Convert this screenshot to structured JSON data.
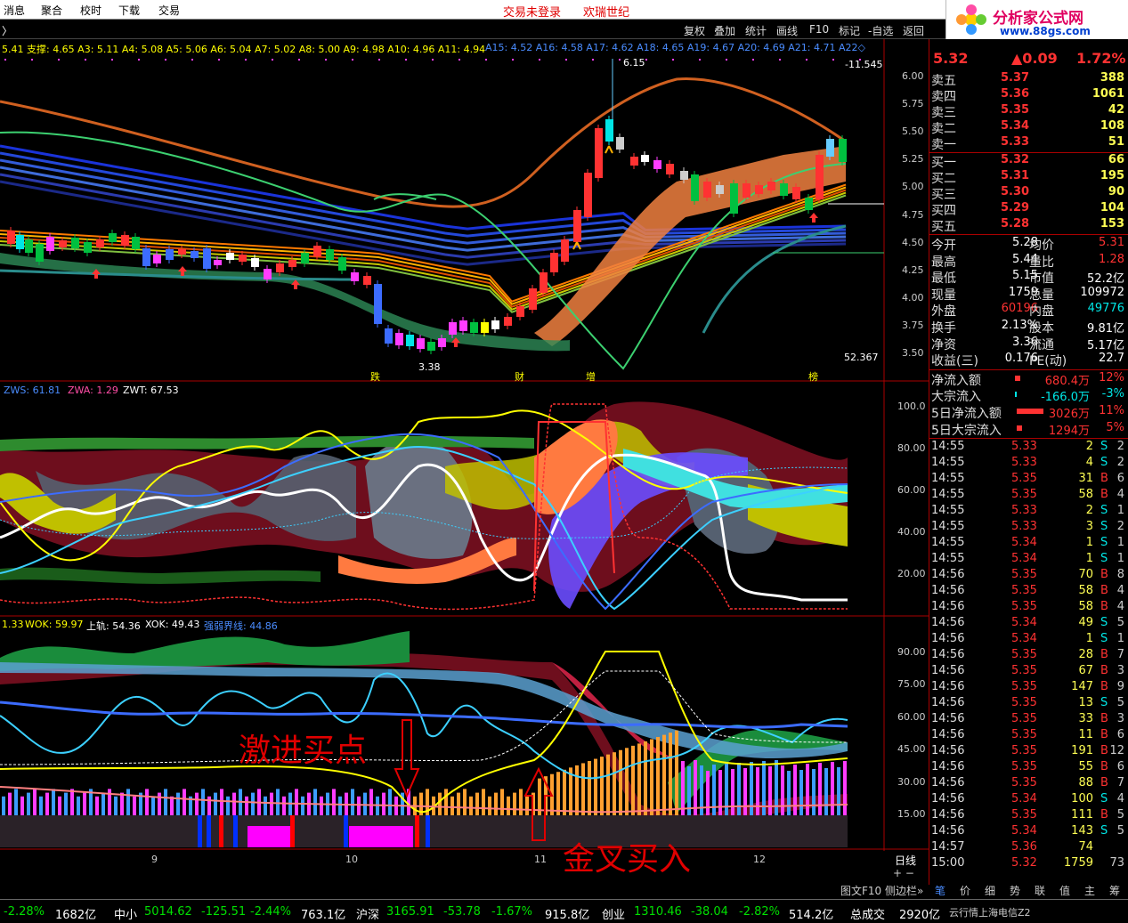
{
  "menu": {
    "items": [
      "消息",
      "聚合",
      "校时",
      "下载",
      "交易"
    ],
    "status": "交易未登录",
    "broker": "欢瑞世纪"
  },
  "logo": {
    "title": "分析家公式网",
    "url": "www.88gs.com"
  },
  "toolbar": {
    "items": [
      "复权",
      "叠加",
      "统计",
      "画线",
      "F10",
      "标记",
      "-自选",
      "返回"
    ]
  },
  "indicator_line": "5.41 支撑: 4.65 A3: 5.11 A4: 5.08 A5: 5.06 A6: 5.04 A7: 5.02 A8: 5.00 A9: 4.98 A10: 4.96 A11: 4.94",
  "indicator_line2": "A15: 4.52 A16: 4.58 A17: 4.62 A18: 4.65 A19: 4.67 A20: 4.69 A21: 4.71 A22◇",
  "main_chart": {
    "right_top": "-11.545",
    "peak": "6.15",
    "low": "3.38",
    "right_bottom": "52.367",
    "y_ticks": [
      "6.00",
      "5.75",
      "5.50",
      "5.25",
      "5.00",
      "4.75",
      "4.50",
      "4.25",
      "4.00",
      "3.75",
      "3.50"
    ],
    "markers": [
      "跌",
      "财",
      "增",
      "榜"
    ]
  },
  "panel2": {
    "legend": [
      "ZWS: 61.81",
      "ZWA: 1.29",
      "ZWT: 67.53"
    ],
    "y_ticks": [
      "100.0",
      "80.00",
      "60.00",
      "40.00",
      "20.00"
    ]
  },
  "panel3": {
    "legend": [
      "1.33",
      "WOK: 59.97",
      "上轨: 54.36",
      "XOK: 49.43",
      "强弱界线: 44.86"
    ],
    "y_ticks": [
      "90.00",
      "75.00",
      "60.00",
      "45.00",
      "30.00",
      "15.00"
    ],
    "annotation1": "激进买点",
    "annotation2": "金叉买入"
  },
  "x_axis": [
    "9",
    "10",
    "11",
    "12"
  ],
  "period": "日线",
  "tabs": [
    "图文F10",
    "侧边栏»",
    "笔",
    "价",
    "细",
    "势",
    "联",
    "值",
    "主",
    "筹"
  ],
  "quote": {
    "price": "5.32",
    "change": "▲0.09",
    "pct": "1.72%"
  },
  "asks": [
    [
      "卖五",
      "5.37",
      "388"
    ],
    [
      "卖四",
      "5.36",
      "1061"
    ],
    [
      "卖三",
      "5.35",
      "42"
    ],
    [
      "卖二",
      "5.34",
      "108"
    ],
    [
      "卖一",
      "5.33",
      "51"
    ]
  ],
  "bids": [
    [
      "买一",
      "5.32",
      "66"
    ],
    [
      "买二",
      "5.31",
      "195"
    ],
    [
      "买三",
      "5.30",
      "90"
    ],
    [
      "买四",
      "5.29",
      "104"
    ],
    [
      "买五",
      "5.28",
      "153"
    ]
  ],
  "stats": [
    [
      "今开",
      "5.28",
      "均价",
      "5.31"
    ],
    [
      "最高",
      "5.44",
      "量比",
      "1.28"
    ],
    [
      "最低",
      "5.15",
      "市值",
      "52.2亿"
    ],
    [
      "现量",
      "1759",
      "总量",
      "109972"
    ],
    [
      "外盘",
      "60196",
      "内盘",
      "49776"
    ],
    [
      "换手",
      "2.13%",
      "股本",
      "9.81亿"
    ],
    [
      "净资",
      "3.36",
      "流通",
      "5.17亿"
    ],
    [
      "收益(三)",
      "0.176",
      "PE(动)",
      "22.7"
    ]
  ],
  "flows": [
    [
      "净流入额",
      "680.4万",
      "12%"
    ],
    [
      "大宗流入",
      "-166.0万",
      "-3%"
    ],
    [
      "5日净流入额",
      "3026万",
      "11%"
    ],
    [
      "5日大宗流入",
      "1294万",
      "5%"
    ]
  ],
  "ticks": [
    [
      "14:55",
      "5.33",
      "2",
      "S",
      "2"
    ],
    [
      "14:55",
      "5.33",
      "4",
      "S",
      "2"
    ],
    [
      "14:55",
      "5.35",
      "31",
      "B",
      "6"
    ],
    [
      "14:55",
      "5.35",
      "58",
      "B",
      "4"
    ],
    [
      "14:55",
      "5.33",
      "2",
      "S",
      "1"
    ],
    [
      "14:55",
      "5.33",
      "3",
      "S",
      "2"
    ],
    [
      "14:55",
      "5.34",
      "1",
      "S",
      "1"
    ],
    [
      "14:55",
      "5.34",
      "1",
      "S",
      "1"
    ],
    [
      "14:56",
      "5.35",
      "70",
      "B",
      "8"
    ],
    [
      "14:56",
      "5.35",
      "58",
      "B",
      "4"
    ],
    [
      "14:56",
      "5.35",
      "58",
      "B",
      "4"
    ],
    [
      "14:56",
      "5.34",
      "49",
      "S",
      "5"
    ],
    [
      "14:56",
      "5.34",
      "1",
      "S",
      "1"
    ],
    [
      "14:56",
      "5.35",
      "28",
      "B",
      "7"
    ],
    [
      "14:56",
      "5.35",
      "67",
      "B",
      "3"
    ],
    [
      "14:56",
      "5.35",
      "147",
      "B",
      "9"
    ],
    [
      "14:56",
      "5.35",
      "13",
      "S",
      "5"
    ],
    [
      "14:56",
      "5.35",
      "33",
      "B",
      "3"
    ],
    [
      "14:56",
      "5.35",
      "11",
      "B",
      "6"
    ],
    [
      "14:56",
      "5.35",
      "191",
      "B",
      "12"
    ],
    [
      "14:56",
      "5.35",
      "55",
      "B",
      "6"
    ],
    [
      "14:56",
      "5.35",
      "88",
      "B",
      "7"
    ],
    [
      "14:56",
      "5.34",
      "100",
      "S",
      "4"
    ],
    [
      "14:56",
      "5.35",
      "111",
      "B",
      "5"
    ],
    [
      "14:56",
      "5.34",
      "143",
      "S",
      "5"
    ],
    [
      "14:57",
      "5.36",
      "74",
      "",
      ""
    ],
    [
      "15:00",
      "5.32",
      "1759",
      "",
      "73"
    ]
  ],
  "bottom": {
    "items": [
      "-2.28%",
      "1682亿",
      "中小",
      "5014.62",
      "-125.51",
      "-2.44%",
      "763.1亿",
      "沪深",
      "3165.91",
      "-53.78",
      "-1.67%",
      "915.8亿",
      "创业",
      "1310.46",
      "-38.04",
      "-2.82%",
      "514.2亿",
      "总成交",
      "2920亿",
      "云行情上海电信Z2"
    ]
  },
  "colors": {
    "up": "#ff3232",
    "down": "#00e6e6",
    "yellow": "#ffff54",
    "bg": "#000000"
  }
}
